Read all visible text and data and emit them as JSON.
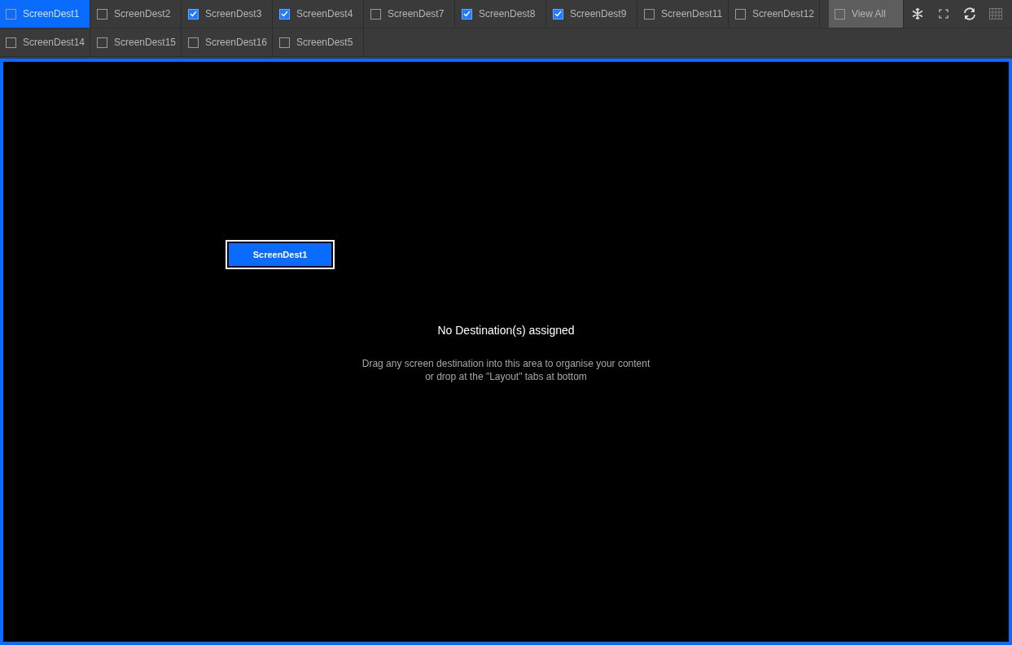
{
  "tabs_row_1": [
    {
      "label": "ScreenDest1",
      "checked": false,
      "selected": true
    },
    {
      "label": "ScreenDest2",
      "checked": false,
      "selected": false
    },
    {
      "label": "ScreenDest3",
      "checked": true,
      "selected": false
    },
    {
      "label": "ScreenDest4",
      "checked": true,
      "selected": false
    },
    {
      "label": "ScreenDest7",
      "checked": false,
      "selected": false
    },
    {
      "label": "ScreenDest8",
      "checked": true,
      "selected": false
    },
    {
      "label": "ScreenDest9",
      "checked": true,
      "selected": false
    },
    {
      "label": "ScreenDest11",
      "checked": false,
      "selected": false
    },
    {
      "label": "ScreenDest12",
      "checked": false,
      "selected": false
    }
  ],
  "tabs_row_2": [
    {
      "label": "ScreenDest14",
      "checked": false,
      "selected": false
    },
    {
      "label": "ScreenDest15",
      "checked": false,
      "selected": false
    },
    {
      "label": "ScreenDest16",
      "checked": false,
      "selected": false
    },
    {
      "label": "ScreenDest5",
      "checked": false,
      "selected": false
    }
  ],
  "view_all": {
    "label": "View All",
    "checked": false
  },
  "canvas": {
    "dragged_item": "ScreenDest1",
    "title": "No Destination(s) assigned",
    "hint_lines": [
      "Drag any screen destination into this area to organise your content",
      "or drop at the \"Layout\" tabs at bottom"
    ]
  }
}
